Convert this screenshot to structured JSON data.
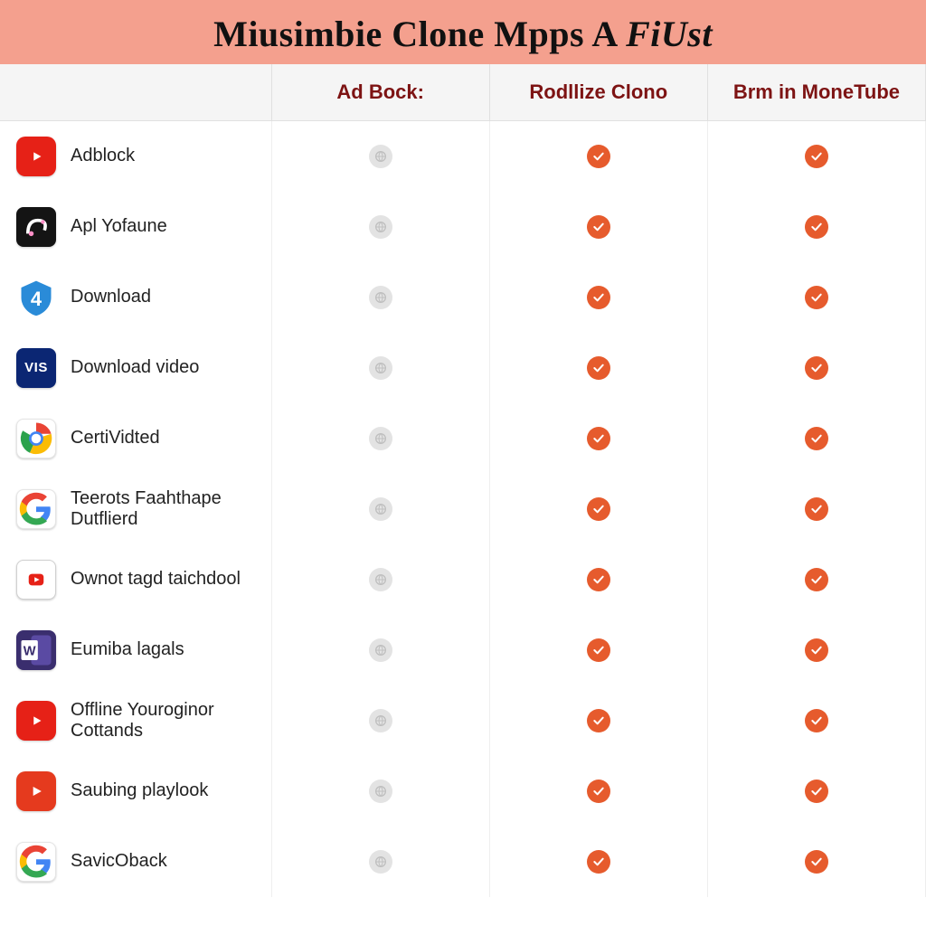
{
  "banner": {
    "title_pre": "Miusimbie Clone Mpps A ",
    "title_ital": "FiUst"
  },
  "columns": {
    "c0": "",
    "c1": "Ad Bock:",
    "c2": "Rodllize Clono",
    "c3": "Brm in MoneTube"
  },
  "status_values": {
    "gray": "gray",
    "orange": "orange"
  },
  "rows": [
    {
      "icon": "youtube",
      "name": "Adblock",
      "c1": "gray",
      "c2": "orange",
      "c3": "orange"
    },
    {
      "icon": "dark",
      "name": "Apl Yofaune",
      "c1": "gray",
      "c2": "orange",
      "c3": "orange"
    },
    {
      "icon": "shield",
      "name": "Download",
      "c1": "gray",
      "c2": "orange",
      "c3": "orange"
    },
    {
      "icon": "vis",
      "name": "Download video",
      "c1": "gray",
      "c2": "orange",
      "c3": "orange"
    },
    {
      "icon": "chrome",
      "name": "CertiVidted",
      "c1": "gray",
      "c2": "orange",
      "c3": "orange"
    },
    {
      "icon": "google",
      "name": "Teerots Faahthape Dutflierd",
      "c1": "gray",
      "c2": "orange",
      "c3": "orange"
    },
    {
      "icon": "youtube-outline",
      "name": "Ownot tagd taichdool",
      "c1": "gray",
      "c2": "orange",
      "c3": "orange"
    },
    {
      "icon": "word",
      "name": "Eumiba lagals",
      "c1": "gray",
      "c2": "orange",
      "c3": "orange"
    },
    {
      "icon": "youtube",
      "name": "Offline Youroginor Cottands",
      "c1": "gray",
      "c2": "orange",
      "c3": "orange"
    },
    {
      "icon": "play",
      "name": "Saubing playlook",
      "c1": "gray",
      "c2": "orange",
      "c3": "orange"
    },
    {
      "icon": "google",
      "name": "SavicOback",
      "c1": "gray",
      "c2": "orange",
      "c3": "orange"
    }
  ],
  "icon_labels": {
    "vis": "VIS",
    "word": "W",
    "shield": "4"
  }
}
